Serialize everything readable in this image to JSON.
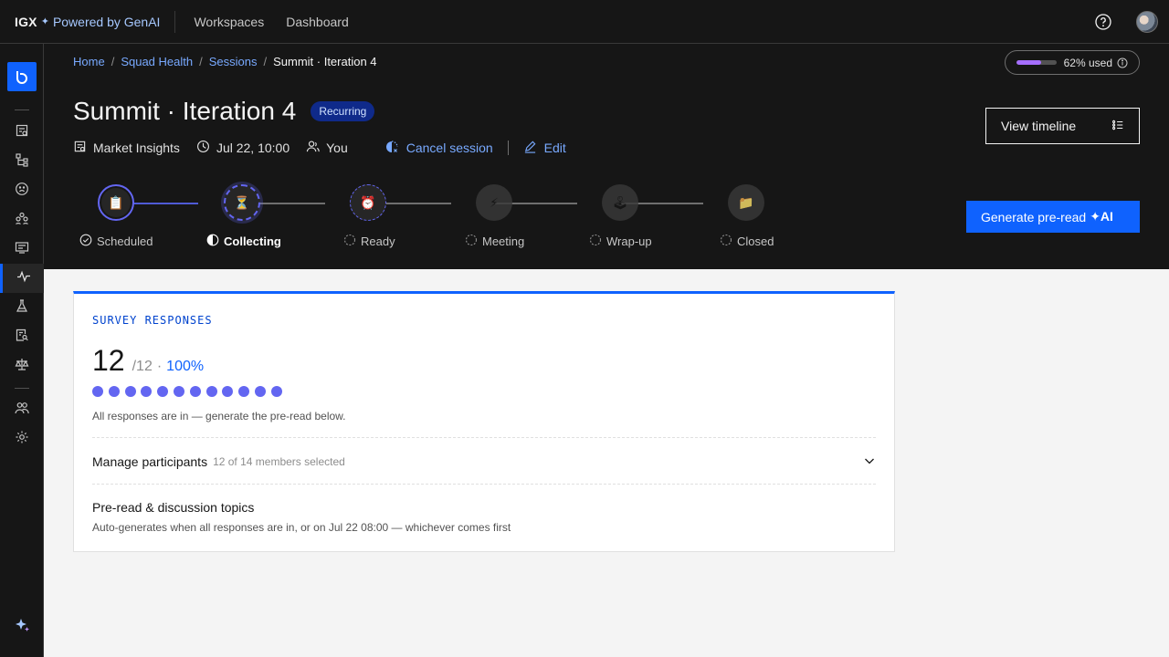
{
  "topbar": {
    "brand_name": "IGX",
    "brand_star": "✦",
    "brand_powered": "Powered by GenAI",
    "nav": [
      "Workspaces",
      "Dashboard"
    ]
  },
  "breadcrumb": {
    "links": [
      "Home",
      "Squad Health",
      "Sessions"
    ],
    "current": "Summit · Iteration 4",
    "separator": "/"
  },
  "usage": {
    "label": "62% used",
    "fraction": 0.62,
    "color": "#a56eff"
  },
  "session": {
    "title": "Summit · Iteration 4",
    "tag": "Recurring",
    "workspace": "Market Insights",
    "datetime": "Jul 22, 10:00",
    "owner": "You",
    "cancel_label": "Cancel session",
    "edit_label": "Edit"
  },
  "actions": {
    "timeline_label": "View timeline",
    "generate_label": "Generate pre-read",
    "generate_ai": "✦AI"
  },
  "stepper": {
    "steps": [
      {
        "label": "Scheduled",
        "icon": "clipboard-emoji",
        "glyph": "📋",
        "state": "done"
      },
      {
        "label": "Collecting",
        "icon": "hourglass-emoji",
        "glyph": "⏳",
        "state": "current"
      },
      {
        "label": "Ready",
        "icon": "alarm-clock-emoji",
        "glyph": "⏰",
        "state": "upcoming"
      },
      {
        "label": "Meeting",
        "icon": "lightning-emoji",
        "glyph": "⚡",
        "state": "pending"
      },
      {
        "label": "Wrap-up",
        "icon": "joystick-emoji",
        "glyph": "🕹",
        "state": "pending"
      },
      {
        "label": "Closed",
        "icon": "folder-emoji",
        "glyph": "📁",
        "state": "pending"
      }
    ]
  },
  "survey": {
    "title": "SURVEY RESPONSES",
    "count": "12",
    "total": "/12",
    "separator": "·",
    "percent": "100%",
    "responses": 12,
    "message": "All responses are in — generate the pre-read below.",
    "manage_label": "Manage participants",
    "manage_sub": "12 of 14 members selected",
    "topics_title": "Pre-read & discussion topics",
    "topics_sub": "Auto-generates when all responses are in, or on Jul 22 08:00 — whichever comes first"
  },
  "colors": {
    "accent": "#0f62fe",
    "dot": "#6366f1",
    "link": "#78a9ff"
  }
}
